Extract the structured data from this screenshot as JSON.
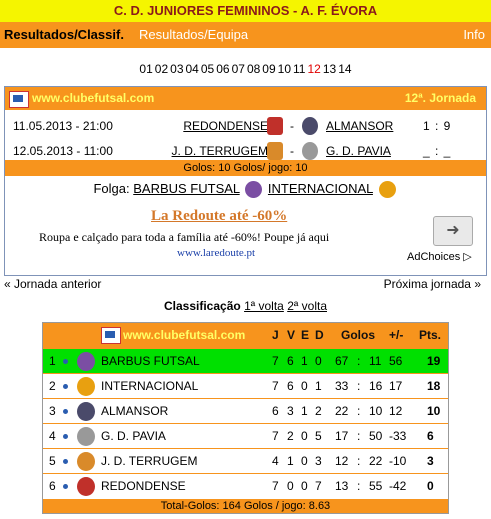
{
  "title": "C. D. JUNIORES FEMININOS - A. F. ÉVORA",
  "nav": {
    "results": "Resultados/Classif.",
    "team": "Resultados/Equipa",
    "info": "Info"
  },
  "rounds": [
    "01",
    "02",
    "03",
    "04",
    "05",
    "06",
    "07",
    "08",
    "09",
    "10",
    "11",
    "12",
    "13",
    "14"
  ],
  "active_round": "12",
  "match_box": {
    "site": "www.clubefutsal.com",
    "round": "12ª. Jornada",
    "matches": [
      {
        "date": "11.05.2013 - 21:00",
        "home": "REDONDENSE",
        "away": "ALMANSOR",
        "score": "1 : 9"
      },
      {
        "date": "12.05.2013 - 11:00",
        "home": "J. D. TERRUGEM",
        "away": "G. D. PAVIA",
        "score": "_ : _"
      }
    ],
    "goals_summary": "Golos: 10      Golos/ jogo: 10",
    "folga_label": "Folga:",
    "folga_teams": [
      "BARBUS FUTSAL",
      "INTERNACIONAL"
    ]
  },
  "ad": {
    "title": "La Redoute até -60%",
    "text": "Roupa e calçado para toda a família até -60%! Poupe já aqui",
    "url": "www.laredoute.pt",
    "choices": "AdChoices"
  },
  "pager": {
    "prev": "« Jornada anterior",
    "next": "Próxima jornada »"
  },
  "classification": {
    "title": "Classificação",
    "volta1": "1ª volta",
    "volta2": "2ª volta",
    "site": "www.clubefutsal.com",
    "headers": {
      "j": "J",
      "v": "V",
      "e": "E",
      "d": "D",
      "golos": "Golos",
      "diff": "+/-",
      "pts": "Pts."
    },
    "rows": [
      {
        "pos": "1",
        "team": "BARBUS FUTSAL",
        "j": "7",
        "v": "6",
        "e": "1",
        "d": "0",
        "gf": "67",
        "ga": "11",
        "diff": "56",
        "pts": "19",
        "crest": "#7b4ea3"
      },
      {
        "pos": "2",
        "team": "INTERNACIONAL",
        "j": "7",
        "v": "6",
        "e": "0",
        "d": "1",
        "gf": "33",
        "ga": "16",
        "diff": "17",
        "pts": "18",
        "crest": "#e8a010"
      },
      {
        "pos": "3",
        "team": "ALMANSOR",
        "j": "6",
        "v": "3",
        "e": "1",
        "d": "2",
        "gf": "22",
        "ga": "10",
        "diff": "12",
        "pts": "10",
        "crest": "#4a4a6a"
      },
      {
        "pos": "4",
        "team": "G. D. PAVIA",
        "j": "7",
        "v": "2",
        "e": "0",
        "d": "5",
        "gf": "17",
        "ga": "50",
        "diff": "-33",
        "pts": "6",
        "crest": "#999999"
      },
      {
        "pos": "5",
        "team": "J. D. TERRUGEM",
        "j": "4",
        "v": "1",
        "e": "0",
        "d": "3",
        "gf": "12",
        "ga": "22",
        "diff": "-10",
        "pts": "3",
        "crest": "#d98a2a"
      },
      {
        "pos": "6",
        "team": "REDONDENSE",
        "j": "7",
        "v": "0",
        "e": "0",
        "d": "7",
        "gf": "13",
        "ga": "55",
        "diff": "-42",
        "pts": "0",
        "crest": "#c0302a"
      }
    ],
    "footer": "Total-Golos: 164      Golos / jogo: 8.63"
  }
}
